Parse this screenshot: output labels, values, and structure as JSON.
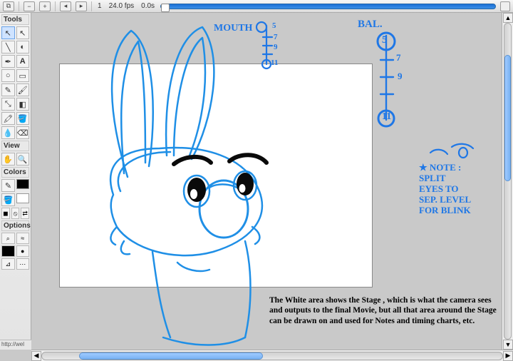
{
  "topbar": {
    "frame_number": "1",
    "fps": "24.0 fps",
    "elapsed": "0.0s"
  },
  "panels": {
    "tools_label": "Tools",
    "view_label": "View",
    "colors_label": "Colors",
    "options_label": "Options"
  },
  "status": {
    "url_hint": "http://wel"
  },
  "annotations": {
    "mouth_label": "MOUTH",
    "mouth_marks": [
      "5",
      "7",
      "9",
      "11"
    ],
    "bal_label": "BAL.",
    "bal_marks": [
      "5",
      "7",
      "9",
      "11"
    ],
    "note": "★ NOTE :\nSPLIT\nEYES TO\nSEP. LEVEL\nFOR BLINK"
  },
  "caption": {
    "text": "The White area shows the Stage , which is what the camera sees and outputs to the final Movie, but all that area around the Stage can be drawn on and used for Notes and timing charts, etc."
  },
  "icons": {
    "arrow": "↖",
    "subselect": "↖",
    "line": "╲",
    "lasso": "◐",
    "pen": "✒",
    "text": "A",
    "oval": "○",
    "rect": "▭",
    "pencil": "✎",
    "brush": "🖌",
    "ink": "🖍",
    "paint": "🪣",
    "eyedrop": "💧",
    "eraser": "⌫",
    "hand": "✋",
    "zoom": "🔍",
    "black": "◼",
    "white": "◻",
    "swap": "⇄",
    "none": "⦸"
  }
}
